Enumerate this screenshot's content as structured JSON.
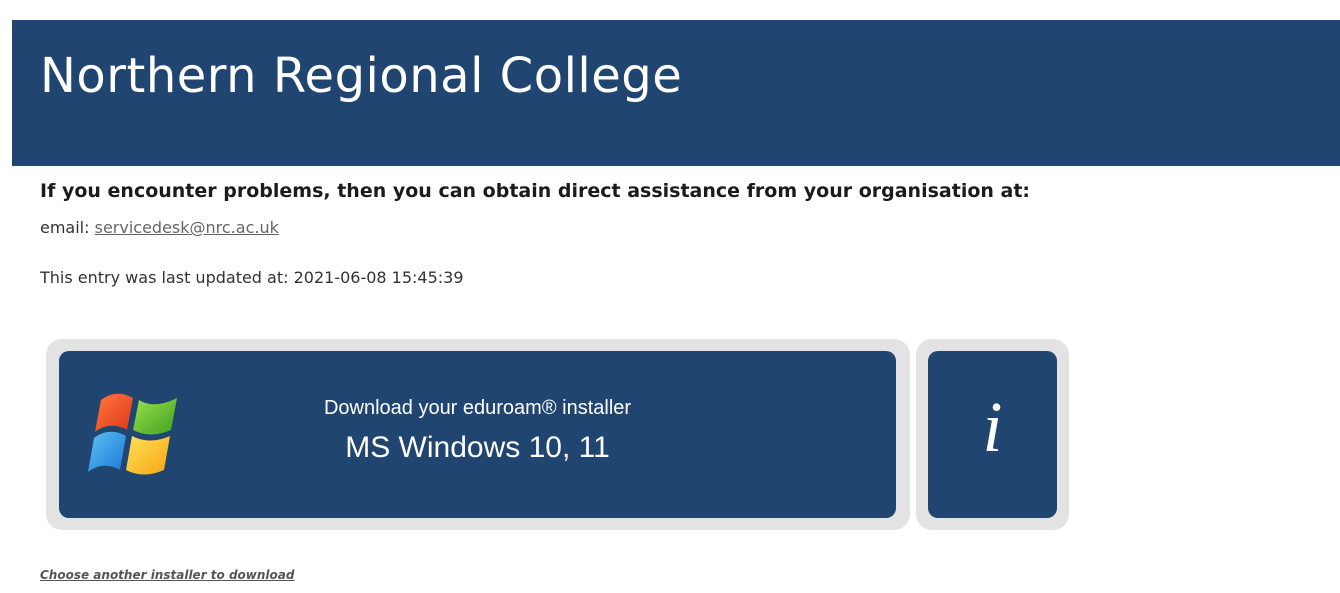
{
  "header": {
    "title": "Northern Regional College"
  },
  "support": {
    "heading": "If you encounter problems, then you can obtain direct assistance from your organisation at:",
    "email_label": "email: ",
    "email": "servicedesk@nrc.ac.uk",
    "updated_text": "This entry was last updated at: 2021-06-08 15:45:39"
  },
  "download": {
    "line1": "Download your eduroam® installer",
    "line2": "MS Windows 10, 11",
    "icon": "windows-logo-icon"
  },
  "info": {
    "glyph": "i",
    "icon": "info-icon"
  },
  "footer": {
    "choose_link": "Choose another installer to download"
  },
  "colors": {
    "brand_blue": "#1f4570",
    "button_frame": "#e3e3e3"
  }
}
